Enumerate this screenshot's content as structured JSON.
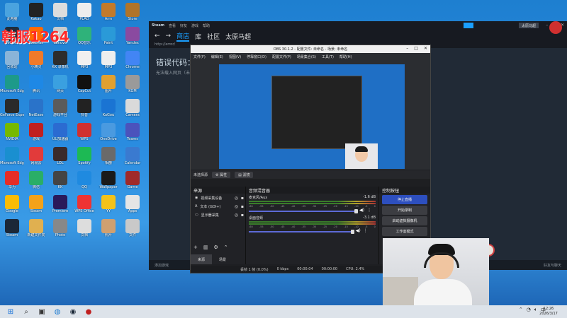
{
  "overlay": {
    "streamer_name": "韩服1264"
  },
  "desktop": {
    "columns": [
      [
        {
          "label": "此电脑",
          "color": "#4aa3df"
        },
        {
          "label": "WeGame",
          "color": "#1e2d3c"
        },
        {
          "label": "回收站",
          "color": "#8ab4d8"
        },
        {
          "label": "Microsoft Edge",
          "color": "#1d9a8a"
        },
        {
          "label": "GeForce Experience",
          "color": "#2a2a2a"
        },
        {
          "label": "NVIDIA",
          "color": "#76b900"
        },
        {
          "label": "Microsoft Edge",
          "color": "#1a8fd0"
        },
        {
          "label": "华为",
          "color": "#e52d27"
        },
        {
          "label": "Google",
          "color": "#fbbc05"
        },
        {
          "label": "Steam",
          "color": "#1b2838"
        }
      ],
      [
        {
          "label": "Kakao",
          "color": "#222"
        },
        {
          "label": "WeChat",
          "color": "#ff6a00"
        },
        {
          "label": "小精灵",
          "color": "#f07a2a"
        },
        {
          "label": "腾讯",
          "color": "#1e88e5"
        },
        {
          "label": "NetEase",
          "color": "#2a73c9"
        },
        {
          "label": "游戏",
          "color": "#c02020"
        },
        {
          "label": "网易云",
          "color": "#e23b3b"
        },
        {
          "label": "微信",
          "color": "#2aae67"
        },
        {
          "label": "Steam",
          "color": "#f3a21a"
        },
        {
          "label": "新建文件夹",
          "color": "#e0b050"
        }
      ],
      [
        {
          "label": "文档",
          "color": "#ddd"
        },
        {
          "label": "Lenovo",
          "color": "#ccc"
        },
        {
          "label": "KK 录像机",
          "color": "#2d2d2d"
        },
        {
          "label": "网页",
          "color": "#3aa0e0"
        },
        {
          "label": "游戏平台",
          "color": "#5b5b5b"
        },
        {
          "label": "UU加速器",
          "color": "#2b6bd1"
        },
        {
          "label": "LOL",
          "color": "#3a2a2a"
        },
        {
          "label": "KK",
          "color": "#444"
        },
        {
          "label": "Premiere",
          "color": "#2a1a5a"
        },
        {
          "label": "Photo",
          "color": "#888"
        }
      ],
      [
        {
          "label": "PLAO",
          "color": "#eee"
        },
        {
          "label": "QQ音乐",
          "color": "#2fb27a"
        },
        {
          "label": "MP3",
          "color": "#f0f0f0"
        },
        {
          "label": "CapCut",
          "color": "#111"
        },
        {
          "label": "抖音",
          "color": "#222"
        },
        {
          "label": "WPS",
          "color": "#d03030"
        },
        {
          "label": "Spotify",
          "color": "#1db954"
        },
        {
          "label": "QQ",
          "color": "#1f8ae0"
        },
        {
          "label": "WPS Office",
          "color": "#e33"
        },
        {
          "label": "文档",
          "color": "#ddd"
        }
      ],
      [
        {
          "label": "Arm",
          "color": "#c37a2a"
        },
        {
          "label": "Paint",
          "color": "#2a9ad8"
        },
        {
          "label": "MP3",
          "color": "#eee"
        },
        {
          "label": "图片",
          "color": "#e0a030"
        },
        {
          "label": "KuGou",
          "color": "#1a74d3"
        },
        {
          "label": "OneDrive",
          "color": "#4a9ae0"
        },
        {
          "label": "相册",
          "color": "#6a6a6a"
        },
        {
          "label": "Wallpaper",
          "color": "#1a1a1a"
        },
        {
          "label": "YY",
          "color": "#f3c21a"
        },
        {
          "label": "照片",
          "color": "#d0a070"
        }
      ],
      [
        {
          "label": "Store",
          "color": "#b0742a"
        },
        {
          "label": "Yandex",
          "color": "#8a4aa0"
        },
        {
          "label": "Chrome",
          "color": "#4285f4"
        },
        {
          "label": "KGM",
          "color": "#9a9a9a"
        },
        {
          "label": "Camera",
          "color": "#dadada"
        },
        {
          "label": "Teams",
          "color": "#4b53bc"
        },
        {
          "label": "Calendar",
          "color": "#3a7ad0"
        },
        {
          "label": "Game",
          "color": "#a02a2a"
        },
        {
          "label": "Apps",
          "color": "#e5e5e5"
        },
        {
          "label": "文件",
          "color": "#c9c9c9"
        }
      ]
    ]
  },
  "steam": {
    "top_items": [
      "Steam",
      "查看",
      "好友",
      "游戏",
      "帮助"
    ],
    "nav": [
      "商店",
      "库",
      "社区",
      "太原马超"
    ],
    "url": "http://error/",
    "user": "太原马超",
    "error_title": "错误代码：",
    "error_sub": "无法载入网页（未知错误）",
    "add_game": "添加游戏",
    "friends": "好友与聊天"
  },
  "obs": {
    "title": "OBS 30.1.2 - 配置文件: 未命名 - 场景: 未命名",
    "menu": [
      "文件(F)",
      "编辑(E)",
      "视图(V)",
      "停靠窗口(D)",
      "配置文件(P)",
      "场景集合(S)",
      "工具(T)",
      "帮助(H)"
    ],
    "no_source": "未选择源",
    "props_label": "属性",
    "filters_label": "滤镜",
    "sources_header": "来源",
    "sources": [
      "视频采集设备",
      "文本 (GDI+)",
      "显示器采集"
    ],
    "mixer_header": "音频混音器",
    "mixer": [
      {
        "name": "麦克风/Aux",
        "db": "-1.6 dB",
        "level": 0.85
      },
      {
        "name": "桌面音频",
        "db": "-3.1 dB",
        "level": 0.82
      }
    ],
    "meter_ticks": [
      "-60",
      "-55",
      "-50",
      "-45",
      "-40",
      "-35",
      "-30",
      "-25",
      "-20",
      "-15",
      "-10",
      "-5",
      "0"
    ],
    "controls_header": "控制按钮",
    "controls": [
      "停止直播",
      "开始录制",
      "启动虚拟摄像机",
      "工作室模式"
    ],
    "tabs": [
      "来源",
      "场景"
    ],
    "status": {
      "dropped": "丢帧 1 帧 (0.0%)",
      "kbps": "0 kbps",
      "rec": "00:00:04",
      "stream": "00:00:00",
      "cpu": "CPU: 2.4%"
    }
  },
  "taskbar": {
    "time": "12:26",
    "date": "2026/3/17"
  }
}
